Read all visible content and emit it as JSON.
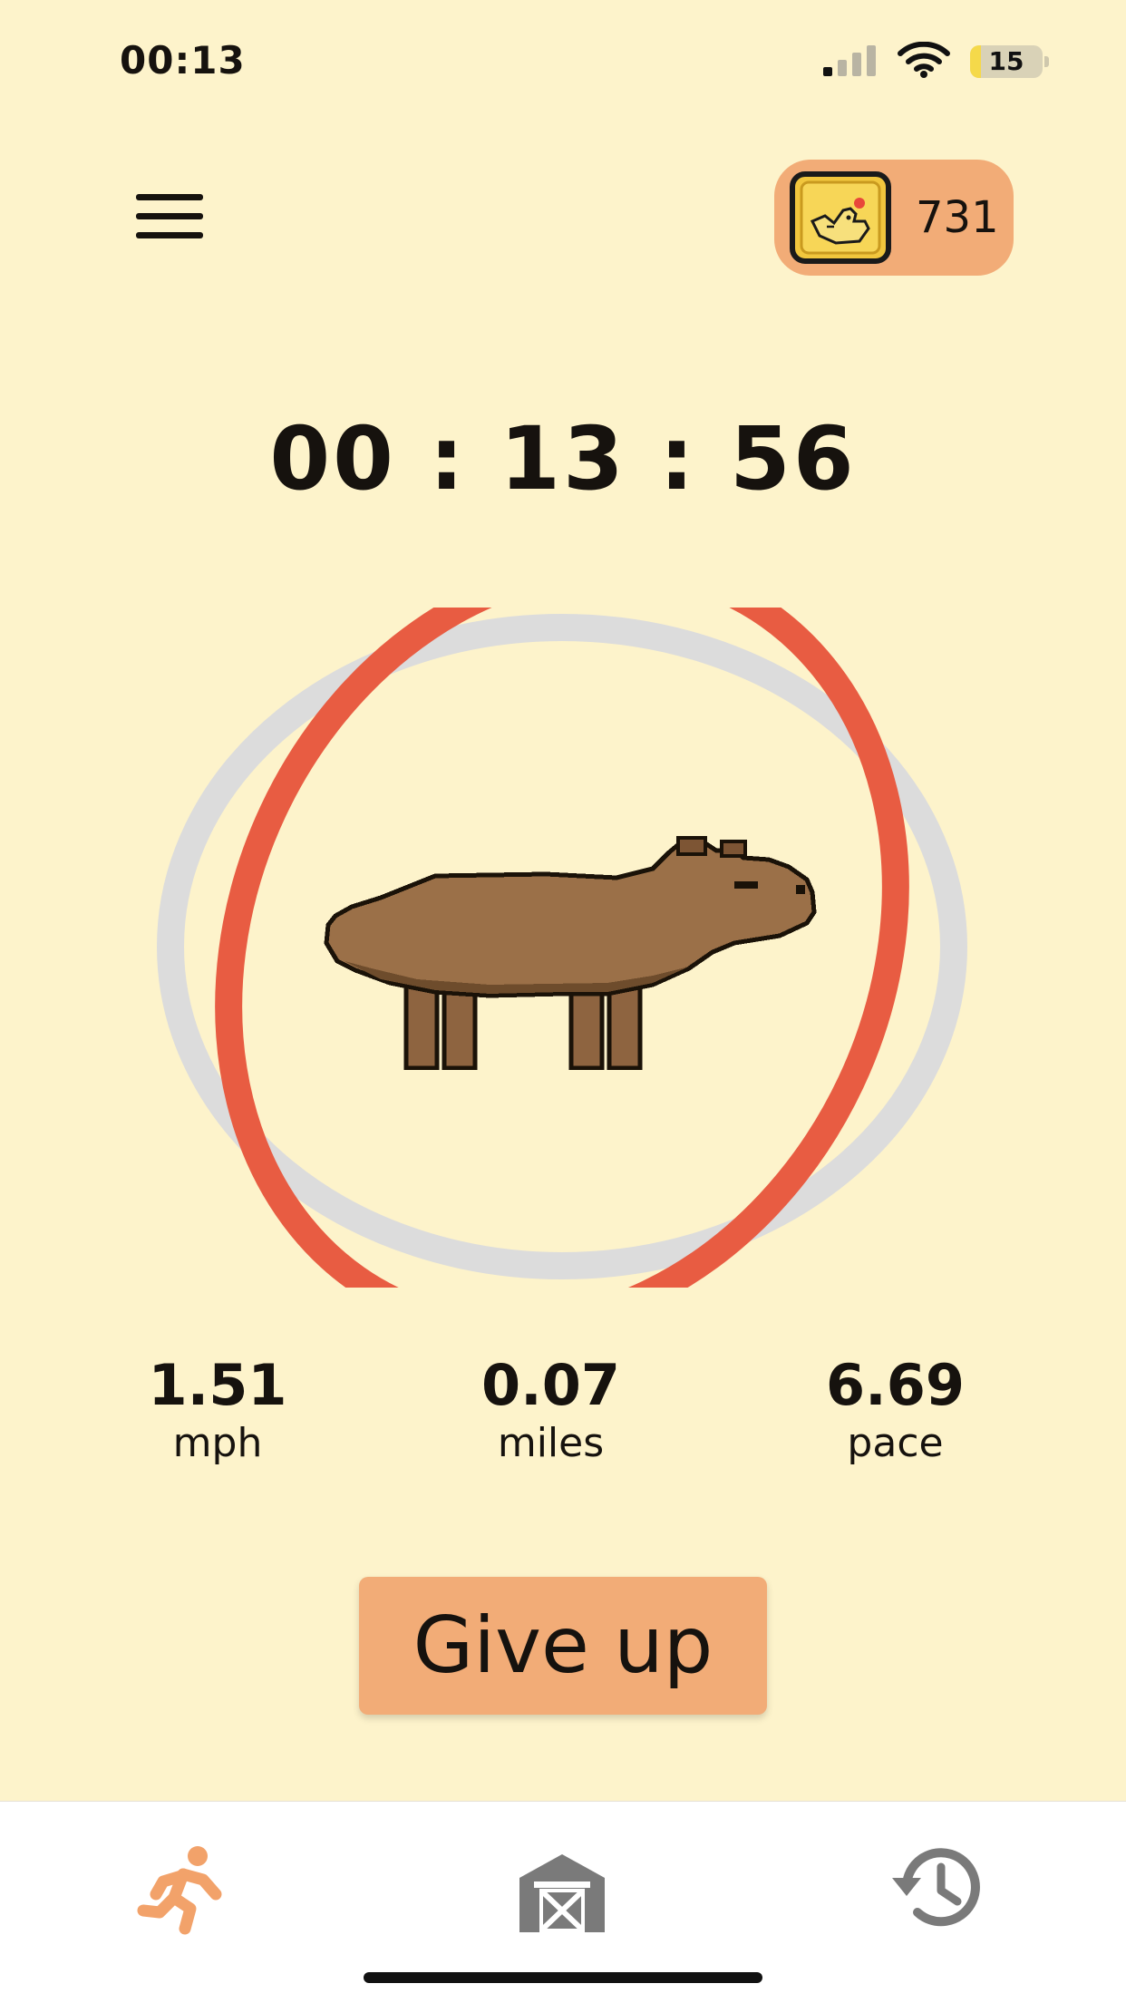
{
  "status_bar": {
    "time": "00:13",
    "battery_level": "15",
    "battery_fraction": 0.15,
    "signal_bars_active": 1,
    "signal_bars_total": 4
  },
  "header": {
    "menu_icon": "hamburger-menu-icon",
    "coin_icon": "chicken-coin-icon",
    "coin_count": "731"
  },
  "timer": {
    "display": "00 : 13 : 56"
  },
  "progress": {
    "fraction": 0.93,
    "color": "#e85c42",
    "track_color": "#dcdcdc"
  },
  "animal": {
    "icon": "capybara-icon"
  },
  "stats": {
    "speed": {
      "value": "1.51",
      "label": "mph"
    },
    "distance": {
      "value": "0.07",
      "label": "miles"
    },
    "pace": {
      "value": "6.69",
      "label": "pace"
    }
  },
  "actions": {
    "give_up_label": "Give up"
  },
  "tab_bar": {
    "tabs": [
      {
        "icon": "running-person-icon",
        "active": true,
        "color": "#f2a26a"
      },
      {
        "icon": "barn-icon",
        "active": false,
        "color": "#7a7a7a"
      },
      {
        "icon": "history-icon",
        "active": false,
        "color": "#7a7a7a"
      }
    ]
  },
  "colors": {
    "background": "#fdf3cb",
    "accent": "#f2ac77",
    "ring": "#e85c42"
  }
}
